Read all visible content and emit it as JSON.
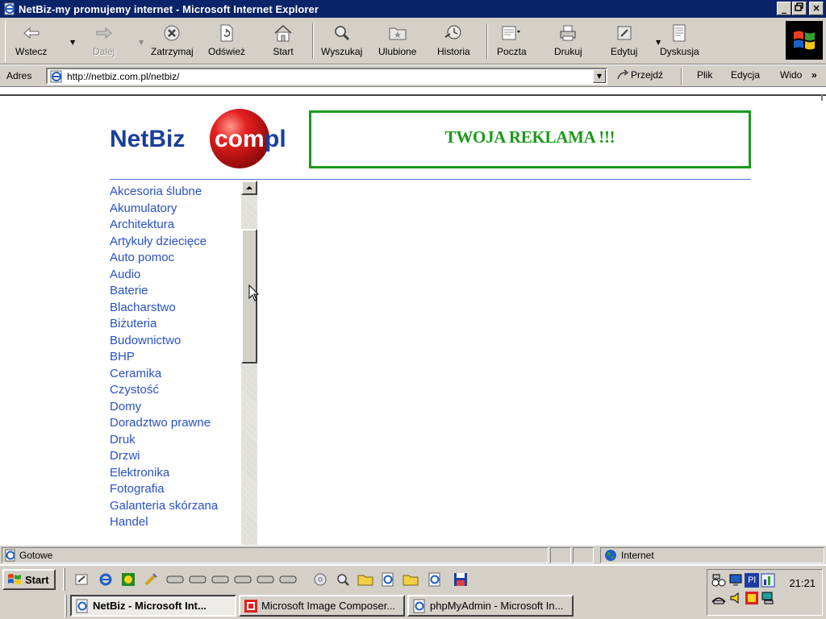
{
  "window": {
    "title": "NetBiz-my promujemy internet - Microsoft Internet Explorer",
    "minimize": "_",
    "maximize": "▫",
    "close": "×"
  },
  "toolbar": {
    "buttons": [
      {
        "label": "Wstecz",
        "icon": "back-arrow-icon"
      },
      {
        "label": "Dalej",
        "icon": "forward-arrow-icon"
      },
      {
        "label": "Zatrzymaj",
        "icon": "stop-icon"
      },
      {
        "label": "Odśwież",
        "icon": "refresh-icon"
      },
      {
        "label": "Start",
        "icon": "home-icon"
      },
      {
        "label": "Wyszukaj",
        "icon": "search-icon"
      },
      {
        "label": "Ulubione",
        "icon": "favorites-icon"
      },
      {
        "label": "Historia",
        "icon": "history-icon"
      },
      {
        "label": "Poczta",
        "icon": "mail-icon"
      },
      {
        "label": "Drukuj",
        "icon": "print-icon"
      },
      {
        "label": "Edytuj",
        "icon": "edit-icon"
      },
      {
        "label": "Dyskusja",
        "icon": "discuss-icon"
      }
    ]
  },
  "address": {
    "label": "Adres",
    "url": "http://netbiz.com.pl/netbiz/",
    "go": "Przejdź",
    "menu": [
      "Plik",
      "Edycja",
      "Wido"
    ],
    "more": "»"
  },
  "page": {
    "logo": {
      "part1": "NetBiz",
      "part2": "com",
      "part3": "pl"
    },
    "ad_text": "TWOJA REKLAMA !!!",
    "categories": [
      "Akcesoria ślubne",
      "Akumulatory",
      "Architektura",
      "Artykuły dziecięce",
      "Auto pomoc",
      "Audio",
      "Baterie",
      "Blacharstwo",
      "Biżuteria",
      "Budownictwo",
      "BHP",
      "Ceramika",
      "Czystość",
      "Domy",
      "Doradztwo prawne",
      "Druk",
      "Drzwi",
      "Elektronika",
      "Fotografia",
      "Galanteria skórzana",
      "Handel"
    ]
  },
  "status": {
    "text": "Gotowe",
    "zone": "Internet"
  },
  "taskbar": {
    "start": "Start",
    "clock": "21:21",
    "tasks": [
      {
        "label": "NetBiz - Microsoft Int...",
        "active": true
      },
      {
        "label": "Microsoft Image Composer...",
        "active": false
      },
      {
        "label": "phpMyAdmin - Microsoft In...",
        "active": false
      }
    ],
    "tray_language": "Pl"
  },
  "colors": {
    "titlebar": "#0a246a",
    "link": "#2850c8",
    "ad_green": "#1a9a1a",
    "logo_blue": "#1a3f9a",
    "logo_red": "#d01010"
  }
}
